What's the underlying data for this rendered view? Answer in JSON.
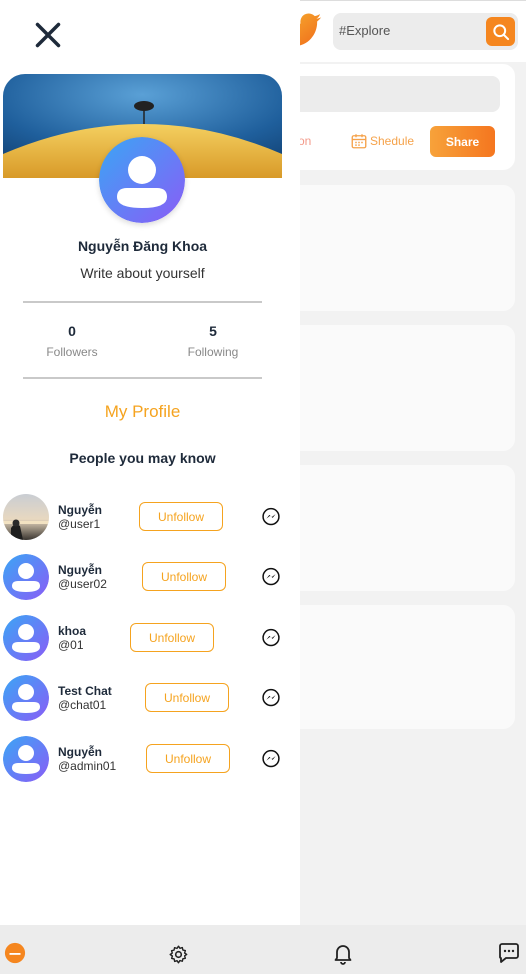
{
  "search": {
    "placeholder": "#Explore"
  },
  "composer": {
    "location_label": "tion",
    "schedule_label": "Shedule",
    "share_label": "Share"
  },
  "profile": {
    "name": "Nguyễn Đăng Khoa",
    "bio": "Write about yourself",
    "followers_count": "0",
    "followers_label": "Followers",
    "following_count": "5",
    "following_label": "Following",
    "my_profile_label": "My Profile"
  },
  "people": {
    "title": "People you may know",
    "items": [
      {
        "name": "Nguyễn",
        "handle": "@user1",
        "button": "Unfollow",
        "avatar": "photo"
      },
      {
        "name": "Nguyễn",
        "handle": "@user02",
        "button": "Unfollow",
        "avatar": "default"
      },
      {
        "name": "khoa",
        "handle": "@01",
        "button": "Unfollow",
        "avatar": "default"
      },
      {
        "name": "Test Chat",
        "handle": "@chat01",
        "button": "Unfollow",
        "avatar": "default"
      },
      {
        "name": "Nguyễn",
        "handle": "@admin01",
        "button": "Unfollow",
        "avatar": "default"
      }
    ]
  },
  "icons": {
    "close": "close-icon",
    "logo": "bird-logo-icon",
    "search": "search-icon",
    "messenger": "messenger-icon",
    "home": "home-icon",
    "settings": "gear-icon",
    "notifications": "bell-icon",
    "chat": "chat-icon"
  },
  "colors": {
    "accent": "#f5a31f",
    "brand": "#f5861f",
    "avatar_gradient_start": "#3aa6f5",
    "avatar_gradient_end": "#8a5cf6"
  }
}
